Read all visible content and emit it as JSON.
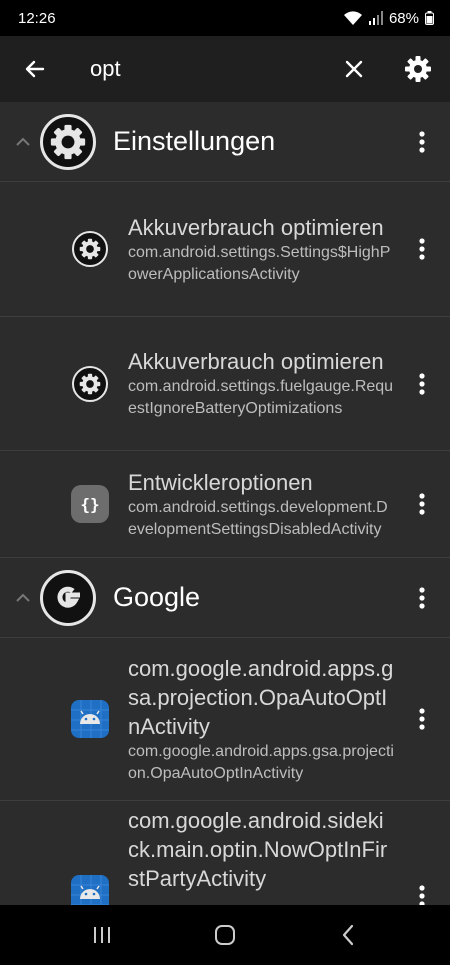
{
  "status": {
    "time": "12:26",
    "battery": "68%"
  },
  "search": {
    "query": "opt"
  },
  "groups": [
    {
      "title": "Einstellungen",
      "items": [
        {
          "title": "Akkuverbrauch optimieren",
          "sub": "com.android.settings.Settings$HighPowerApplicationsActivity"
        },
        {
          "title": "Akkuverbrauch optimieren",
          "sub": "com.android.settings.fuelgauge.RequestIgnoreBatteryOptimizations"
        },
        {
          "title": "Entwickleroptionen",
          "sub": "com.android.settings.development.DevelopmentSettingsDisabledActivity",
          "icon_text": "{}"
        }
      ]
    },
    {
      "title": "Google",
      "items": [
        {
          "title": "com.google.android.apps.gsa.projection.OpaAutoOptInActivity",
          "sub": "com.google.android.apps.gsa.projection.OpaAutoOptInActivity"
        },
        {
          "title": "com.google.android.sidekick.main.optin.NowOptInFirstPartyActivity"
        }
      ]
    }
  ]
}
